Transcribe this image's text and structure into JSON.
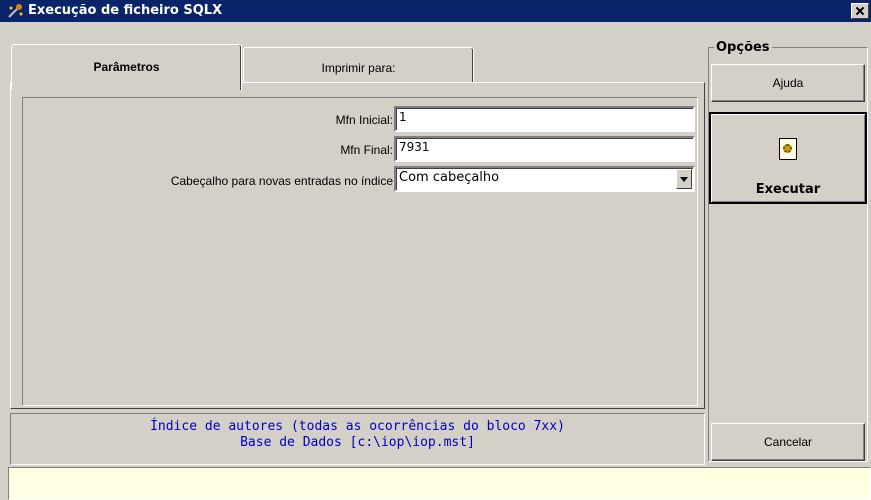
{
  "window": {
    "title": "Execução de ficheiro SQLX"
  },
  "tabs": [
    {
      "label": "Parâmetros",
      "active": true
    },
    {
      "label": "Imprimir para:",
      "active": false
    }
  ],
  "params": {
    "mfn_inicial_label": "Mfn Inicial:",
    "mfn_inicial_value": "1",
    "mfn_final_label": "Mfn Final:",
    "mfn_final_value": "7931",
    "cabecalho_label": "Cabeçalho para novas entradas no índice",
    "cabecalho_value": "Com cabeçalho"
  },
  "info": {
    "line1": "Índice de autores (todas as ocorrências do bloco 7xx)",
    "line2": "Base de Dados [c:\\iop\\iop.mst]"
  },
  "opcoes": {
    "title": "Opções",
    "ajuda_label": "Ajuda",
    "executar_label": "Executar",
    "cancelar_label": "Cancelar"
  },
  "colors": {
    "titlebar": "#0a246a",
    "info_text": "#0000c0",
    "statusbar": "#ffffe1",
    "face": "#d4d0c8"
  }
}
